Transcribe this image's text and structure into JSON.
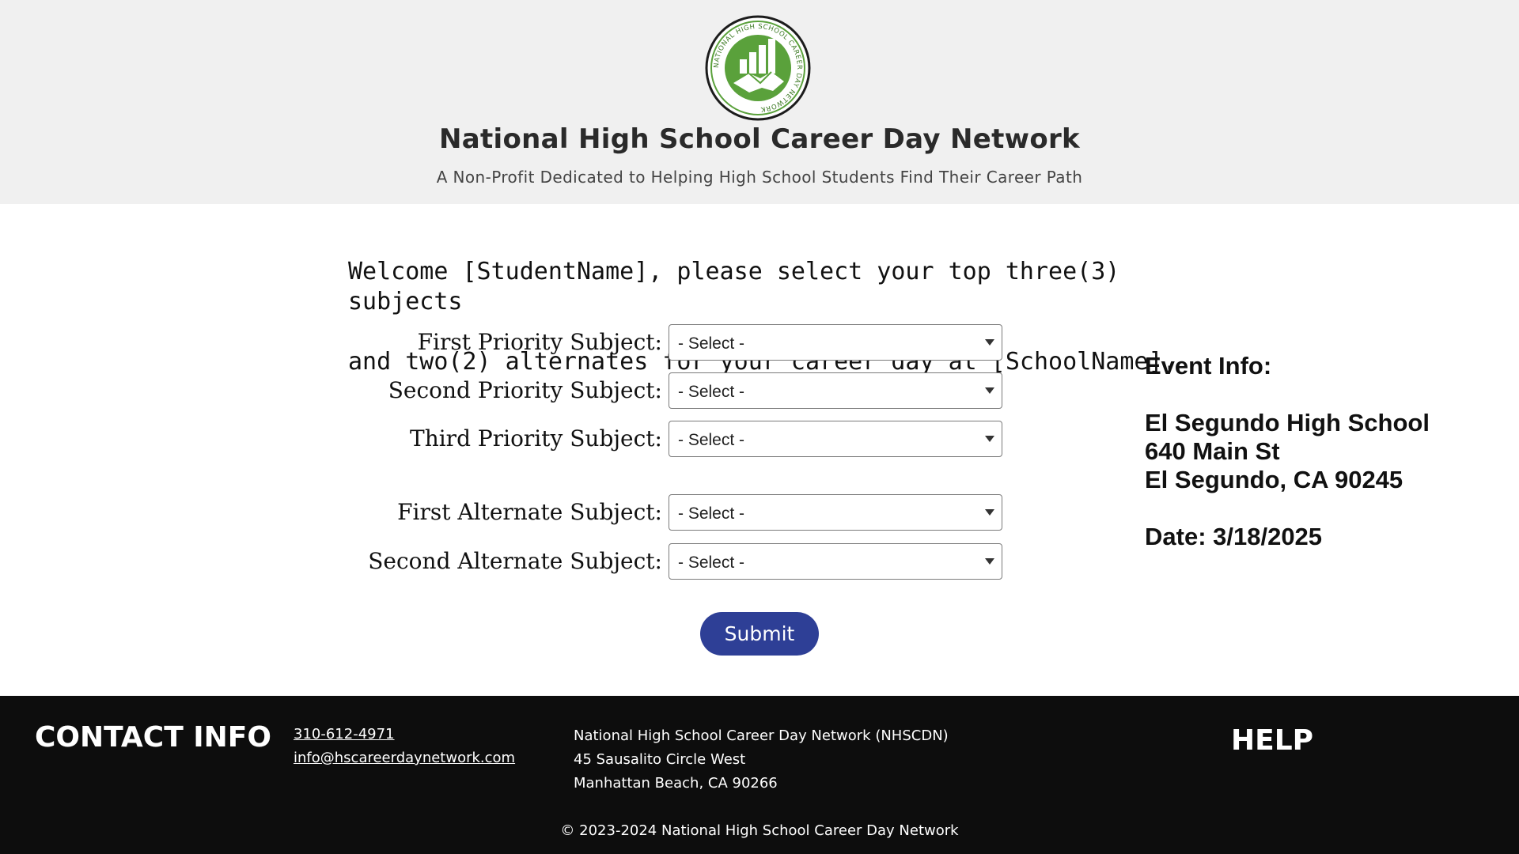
{
  "header": {
    "logo_text": "NATIONAL HIGH SCHOOL CAREER DAY NETWORK",
    "title": "National High School Career Day Network",
    "tagline": "A Non-Profit Dedicated to Helping High School Students Find Their Career Path",
    "logo_color": "#5aa13b"
  },
  "welcome": {
    "line1": "Welcome [StudentName], please select your top three(3) subjects",
    "line2": "and two(2) alternates for your career day at [SchoolName]."
  },
  "form": {
    "rows": [
      {
        "label": "First Priority Subject:",
        "value": "- Select -"
      },
      {
        "label": "Second Priority Subject:",
        "value": "- Select -"
      },
      {
        "label": "Third Priority Subject:",
        "value": "- Select -"
      },
      {
        "label": "First Alternate Subject:",
        "value": "- Select -"
      },
      {
        "label": "Second Alternate Subject:",
        "value": "- Select -"
      }
    ],
    "submit_label": "Submit",
    "submit_color": "#2e3f96"
  },
  "event_info": {
    "heading": "Event Info:",
    "school": "El Segundo High School",
    "street": "640 Main St",
    "city": "El Segundo, CA 90245",
    "date": "Date: 3/18/2025"
  },
  "footer": {
    "contact_heading": "CONTACT INFO",
    "phone": "310-612-4971",
    "email": "info@hscareerdaynetwork.com",
    "org_name": "National High School Career Day Network (NHSCDN)",
    "address_line1": "45 Sausalito Circle West",
    "address_line2": "Manhattan Beach, CA 90266",
    "help": "HELP",
    "copyright": "© 2023-2024 National High School Career Day Network",
    "background": "#0d0d0d"
  }
}
